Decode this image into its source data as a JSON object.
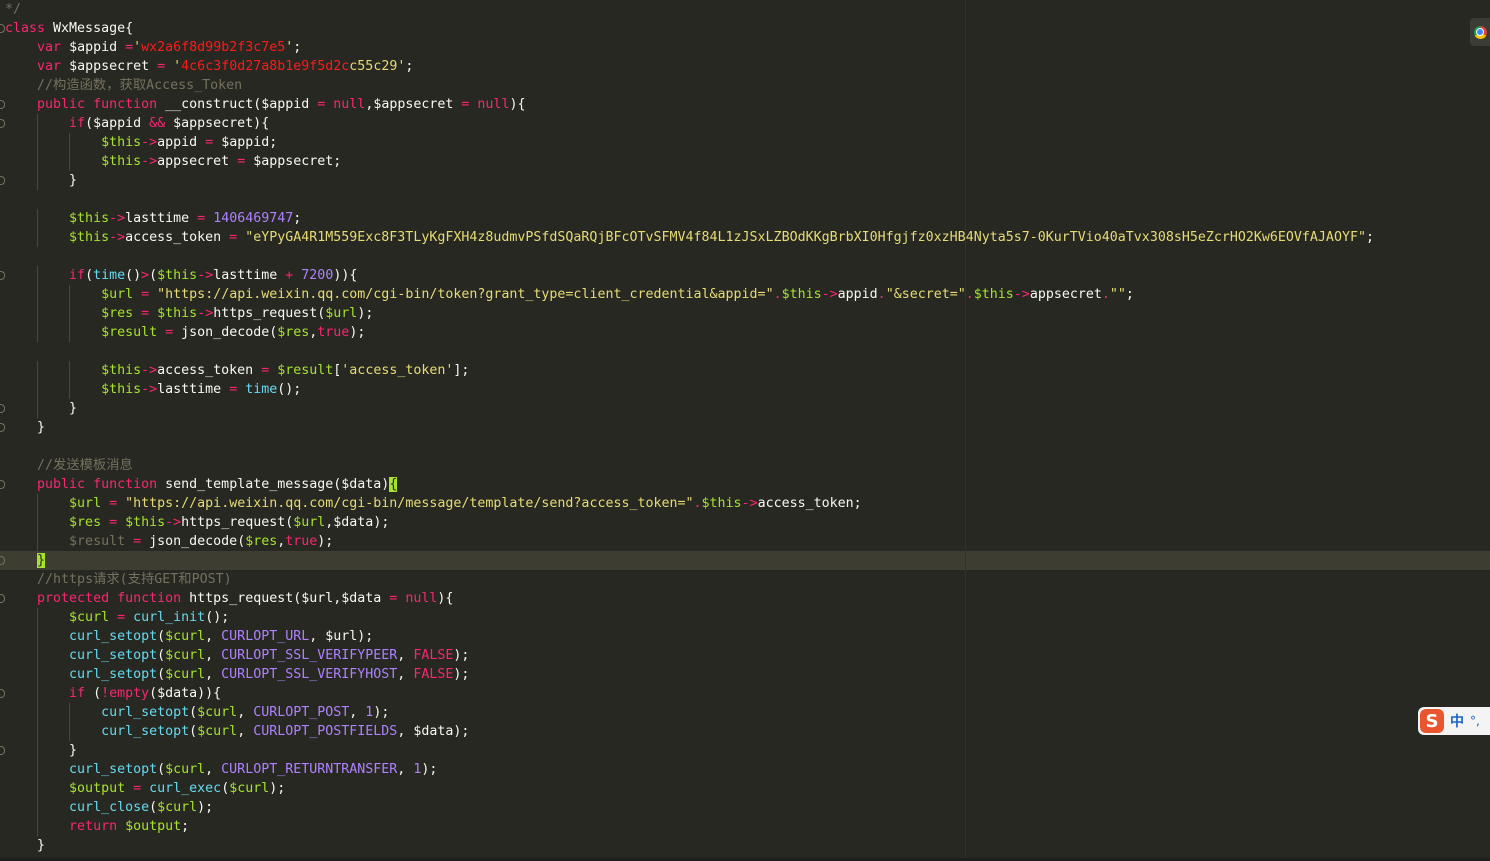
{
  "editor": {
    "theme": {
      "background": "#272822",
      "keyword": "#f92672",
      "string": "#e6db74",
      "variable": "#a6e22e",
      "builtin": "#66d9ef",
      "comment": "#75715e",
      "number": "#ae81ff"
    },
    "lines": [
      {
        "fold": false,
        "indent": 0,
        "tokens": [
          [
            "c",
            "*/"
          ]
        ]
      },
      {
        "fold": true,
        "indent": 0,
        "tokens": [
          [
            "k",
            "class"
          ],
          [
            "d",
            " WxMessage{"
          ]
        ]
      },
      {
        "fold": false,
        "indent": 1,
        "tokens": [
          [
            "k",
            "var"
          ],
          [
            "d",
            " $appid "
          ],
          [
            "o",
            "="
          ],
          [
            "s",
            "'"
          ],
          [
            "r",
            "wx2a6f8d99b2f3c7e5"
          ],
          [
            "s",
            "'"
          ],
          [
            "d",
            ";"
          ]
        ]
      },
      {
        "fold": false,
        "indent": 1,
        "tokens": [
          [
            "k",
            "var"
          ],
          [
            "d",
            " $appsecret "
          ],
          [
            "o",
            "="
          ],
          [
            "s",
            " '"
          ],
          [
            "r",
            "4c6c3f0d27a8b1e9f5d2c"
          ],
          [
            "s",
            "c55c29'"
          ],
          [
            "d",
            ";"
          ]
        ]
      },
      {
        "fold": false,
        "indent": 1,
        "tokens": [
          [
            "c",
            "//构造函数，获取Access_Token"
          ]
        ]
      },
      {
        "fold": true,
        "indent": 1,
        "tokens": [
          [
            "k",
            "public"
          ],
          [
            "d",
            " "
          ],
          [
            "k",
            "function"
          ],
          [
            "d",
            " __construct($appid "
          ],
          [
            "o",
            "="
          ],
          [
            "d",
            " "
          ],
          [
            "k",
            "null"
          ],
          [
            "d",
            ",$appsecret "
          ],
          [
            "o",
            "="
          ],
          [
            "d",
            " "
          ],
          [
            "k",
            "null"
          ],
          [
            "d",
            "){"
          ]
        ]
      },
      {
        "fold": true,
        "indent": 2,
        "tokens": [
          [
            "k",
            "if"
          ],
          [
            "d",
            "($appid "
          ],
          [
            "o",
            "&&"
          ],
          [
            "d",
            " $appsecret){"
          ]
        ]
      },
      {
        "fold": false,
        "indent": 3,
        "tokens": [
          [
            "v",
            "$this"
          ],
          [
            "o",
            "->"
          ],
          [
            "d",
            "appid "
          ],
          [
            "o",
            "="
          ],
          [
            "d",
            " $appid;"
          ]
        ]
      },
      {
        "fold": false,
        "indent": 3,
        "tokens": [
          [
            "v",
            "$this"
          ],
          [
            "o",
            "->"
          ],
          [
            "d",
            "appsecret "
          ],
          [
            "o",
            "="
          ],
          [
            "d",
            " $appsecret;"
          ]
        ]
      },
      {
        "fold": true,
        "indent": 2,
        "tokens": [
          [
            "d",
            "}"
          ]
        ]
      },
      {
        "fold": false,
        "indent": 0,
        "tokens": []
      },
      {
        "fold": false,
        "indent": 2,
        "tokens": [
          [
            "v",
            "$this"
          ],
          [
            "o",
            "->"
          ],
          [
            "d",
            "lasttime "
          ],
          [
            "o",
            "="
          ],
          [
            "d",
            " "
          ],
          [
            "n",
            "1406469747"
          ],
          [
            "d",
            ";"
          ]
        ]
      },
      {
        "fold": false,
        "indent": 2,
        "tokens": [
          [
            "v",
            "$this"
          ],
          [
            "o",
            "->"
          ],
          [
            "d",
            "access_token "
          ],
          [
            "o",
            "="
          ],
          [
            "d",
            " "
          ],
          [
            "s",
            "\"eYPyGA4R1M559Exc8F3TLyKgFXH4z8udmvPSfdSQaRQjBFcOTvSFMV4f84L1zJSxLZBOdKKgBrbXI0Hfgjfz0xzHB4Nyta5s7-0KurTVio40aTvx308sH5eZcrHO2Kw6EOVfAJAOYF\""
          ],
          [
            "d",
            ";"
          ]
        ]
      },
      {
        "fold": false,
        "indent": 0,
        "tokens": []
      },
      {
        "fold": true,
        "indent": 2,
        "tokens": [
          [
            "k",
            "if"
          ],
          [
            "d",
            "("
          ],
          [
            "f",
            "time"
          ],
          [
            "d",
            "()"
          ],
          [
            "o",
            ">"
          ],
          [
            "d",
            "("
          ],
          [
            "v",
            "$this"
          ],
          [
            "o",
            "->"
          ],
          [
            "d",
            "lasttime "
          ],
          [
            "o",
            "+"
          ],
          [
            "d",
            " "
          ],
          [
            "n",
            "7200"
          ],
          [
            "d",
            ")){"
          ]
        ]
      },
      {
        "fold": false,
        "indent": 3,
        "tokens": [
          [
            "v",
            "$url"
          ],
          [
            "d",
            " "
          ],
          [
            "o",
            "="
          ],
          [
            "d",
            " "
          ],
          [
            "s",
            "\"https://api.weixin.qq.com/cgi-bin/token?grant_type=client_credential&appid=\""
          ],
          [
            "o",
            "."
          ],
          [
            "v",
            "$this"
          ],
          [
            "o",
            "->"
          ],
          [
            "d",
            "appid"
          ],
          [
            "o",
            "."
          ],
          [
            "s",
            "\"&secret=\""
          ],
          [
            "o",
            "."
          ],
          [
            "v",
            "$this"
          ],
          [
            "o",
            "->"
          ],
          [
            "d",
            "appsecret"
          ],
          [
            "o",
            "."
          ],
          [
            "s",
            "\"\""
          ],
          [
            "d",
            ";"
          ]
        ]
      },
      {
        "fold": false,
        "indent": 3,
        "tokens": [
          [
            "v",
            "$res"
          ],
          [
            "d",
            " "
          ],
          [
            "o",
            "="
          ],
          [
            "d",
            " "
          ],
          [
            "v",
            "$this"
          ],
          [
            "o",
            "->"
          ],
          [
            "d",
            "https_request("
          ],
          [
            "v",
            "$url"
          ],
          [
            "d",
            ");"
          ]
        ]
      },
      {
        "fold": false,
        "indent": 3,
        "tokens": [
          [
            "v",
            "$result"
          ],
          [
            "d",
            " "
          ],
          [
            "o",
            "="
          ],
          [
            "d",
            " json_decode("
          ],
          [
            "v",
            "$res"
          ],
          [
            "d",
            ","
          ],
          [
            "k",
            "true"
          ],
          [
            "d",
            ");"
          ]
        ]
      },
      {
        "fold": false,
        "indent": 0,
        "tokens": []
      },
      {
        "fold": false,
        "indent": 3,
        "tokens": [
          [
            "v",
            "$this"
          ],
          [
            "o",
            "->"
          ],
          [
            "d",
            "access_token "
          ],
          [
            "o",
            "="
          ],
          [
            "d",
            " "
          ],
          [
            "v",
            "$result"
          ],
          [
            "d",
            "["
          ],
          [
            "s",
            "'access_token'"
          ],
          [
            "d",
            "];"
          ]
        ]
      },
      {
        "fold": false,
        "indent": 3,
        "tokens": [
          [
            "v",
            "$this"
          ],
          [
            "o",
            "->"
          ],
          [
            "d",
            "lasttime "
          ],
          [
            "o",
            "="
          ],
          [
            "d",
            " "
          ],
          [
            "f",
            "time"
          ],
          [
            "d",
            "();"
          ]
        ]
      },
      {
        "fold": true,
        "indent": 2,
        "tokens": [
          [
            "d",
            "}"
          ]
        ]
      },
      {
        "fold": true,
        "indent": 1,
        "tokens": [
          [
            "d",
            "}"
          ]
        ]
      },
      {
        "fold": false,
        "indent": 0,
        "tokens": []
      },
      {
        "fold": false,
        "indent": 1,
        "tokens": [
          [
            "c",
            "//发送模板消息"
          ]
        ]
      },
      {
        "fold": true,
        "indent": 1,
        "tokens": [
          [
            "k",
            "public"
          ],
          [
            "d",
            " "
          ],
          [
            "k",
            "function"
          ],
          [
            "d",
            " send_template_message($data)"
          ],
          [
            "h",
            "{"
          ]
        ]
      },
      {
        "fold": false,
        "indent": 2,
        "tokens": [
          [
            "v",
            "$url"
          ],
          [
            "d",
            " "
          ],
          [
            "o",
            "="
          ],
          [
            "d",
            " "
          ],
          [
            "s",
            "\"https://api.weixin.qq.com/cgi-bin/message/template/send?access_token=\""
          ],
          [
            "o",
            "."
          ],
          [
            "v",
            "$this"
          ],
          [
            "o",
            "->"
          ],
          [
            "d",
            "access_token;"
          ]
        ]
      },
      {
        "fold": false,
        "indent": 2,
        "tokens": [
          [
            "v",
            "$res"
          ],
          [
            "d",
            " "
          ],
          [
            "o",
            "="
          ],
          [
            "d",
            " "
          ],
          [
            "v",
            "$this"
          ],
          [
            "o",
            "->"
          ],
          [
            "d",
            "https_request("
          ],
          [
            "v",
            "$url"
          ],
          [
            "d",
            ",$data);"
          ]
        ]
      },
      {
        "fold": false,
        "indent": 2,
        "tokens": [
          [
            "c",
            "$result"
          ],
          [
            "d",
            " "
          ],
          [
            "o",
            "="
          ],
          [
            "d",
            " json_decode("
          ],
          [
            "v",
            "$res"
          ],
          [
            "d",
            ","
          ],
          [
            "k",
            "true"
          ],
          [
            "d",
            ");"
          ]
        ]
      },
      {
        "fold": true,
        "indent": 1,
        "current": true,
        "tokens": [
          [
            "h",
            "}"
          ]
        ]
      },
      {
        "fold": false,
        "indent": 1,
        "tokens": [
          [
            "c",
            "//https请求(支持GET和POST)"
          ]
        ]
      },
      {
        "fold": true,
        "indent": 1,
        "tokens": [
          [
            "k",
            "protected"
          ],
          [
            "d",
            " "
          ],
          [
            "k",
            "function"
          ],
          [
            "d",
            " https_request($url,$data "
          ],
          [
            "o",
            "="
          ],
          [
            "d",
            " "
          ],
          [
            "k",
            "null"
          ],
          [
            "d",
            "){"
          ]
        ]
      },
      {
        "fold": false,
        "indent": 2,
        "tokens": [
          [
            "v",
            "$curl"
          ],
          [
            "d",
            " "
          ],
          [
            "o",
            "="
          ],
          [
            "d",
            " "
          ],
          [
            "f",
            "curl_init"
          ],
          [
            "d",
            "();"
          ]
        ]
      },
      {
        "fold": false,
        "indent": 2,
        "tokens": [
          [
            "f",
            "curl_setopt"
          ],
          [
            "d",
            "("
          ],
          [
            "v",
            "$curl"
          ],
          [
            "d",
            ", "
          ],
          [
            "n",
            "CURLOPT_URL"
          ],
          [
            "d",
            ", $url);"
          ]
        ]
      },
      {
        "fold": false,
        "indent": 2,
        "tokens": [
          [
            "f",
            "curl_setopt"
          ],
          [
            "d",
            "("
          ],
          [
            "v",
            "$curl"
          ],
          [
            "d",
            ", "
          ],
          [
            "n",
            "CURLOPT_SSL_VERIFYPEER"
          ],
          [
            "d",
            ", "
          ],
          [
            "k",
            "FALSE"
          ],
          [
            "d",
            ");"
          ]
        ]
      },
      {
        "fold": false,
        "indent": 2,
        "tokens": [
          [
            "f",
            "curl_setopt"
          ],
          [
            "d",
            "("
          ],
          [
            "v",
            "$curl"
          ],
          [
            "d",
            ", "
          ],
          [
            "n",
            "CURLOPT_SSL_VERIFYHOST"
          ],
          [
            "d",
            ", "
          ],
          [
            "k",
            "FALSE"
          ],
          [
            "d",
            ");"
          ]
        ]
      },
      {
        "fold": true,
        "indent": 2,
        "tokens": [
          [
            "k",
            "if"
          ],
          [
            "d",
            " ("
          ],
          [
            "o",
            "!"
          ],
          [
            "k",
            "empty"
          ],
          [
            "d",
            "($data)){"
          ]
        ]
      },
      {
        "fold": false,
        "indent": 3,
        "tokens": [
          [
            "f",
            "curl_setopt"
          ],
          [
            "d",
            "("
          ],
          [
            "v",
            "$curl"
          ],
          [
            "d",
            ", "
          ],
          [
            "n",
            "CURLOPT_POST"
          ],
          [
            "d",
            ", "
          ],
          [
            "n",
            "1"
          ],
          [
            "d",
            ");"
          ]
        ]
      },
      {
        "fold": false,
        "indent": 3,
        "tokens": [
          [
            "f",
            "curl_setopt"
          ],
          [
            "d",
            "("
          ],
          [
            "v",
            "$curl"
          ],
          [
            "d",
            ", "
          ],
          [
            "n",
            "CURLOPT_POSTFIELDS"
          ],
          [
            "d",
            ", $data);"
          ]
        ]
      },
      {
        "fold": true,
        "indent": 2,
        "tokens": [
          [
            "d",
            "}"
          ]
        ]
      },
      {
        "fold": false,
        "indent": 2,
        "tokens": [
          [
            "f",
            "curl_setopt"
          ],
          [
            "d",
            "("
          ],
          [
            "v",
            "$curl"
          ],
          [
            "d",
            ", "
          ],
          [
            "n",
            "CURLOPT_RETURNTRANSFER"
          ],
          [
            "d",
            ", "
          ],
          [
            "n",
            "1"
          ],
          [
            "d",
            ");"
          ]
        ]
      },
      {
        "fold": false,
        "indent": 2,
        "tokens": [
          [
            "v",
            "$output"
          ],
          [
            "d",
            " "
          ],
          [
            "o",
            "="
          ],
          [
            "d",
            " "
          ],
          [
            "f",
            "curl_exec"
          ],
          [
            "d",
            "("
          ],
          [
            "v",
            "$curl"
          ],
          [
            "d",
            ");"
          ]
        ]
      },
      {
        "fold": false,
        "indent": 2,
        "tokens": [
          [
            "f",
            "curl_close"
          ],
          [
            "d",
            "("
          ],
          [
            "v",
            "$curl"
          ],
          [
            "d",
            ");"
          ]
        ]
      },
      {
        "fold": false,
        "indent": 2,
        "tokens": [
          [
            "k",
            "return"
          ],
          [
            "d",
            " "
          ],
          [
            "v",
            "$output"
          ],
          [
            "d",
            ";"
          ]
        ]
      },
      {
        "fold": false,
        "indent": 1,
        "tokens": [
          [
            "d",
            "}"
          ]
        ]
      }
    ]
  },
  "overlays": {
    "browser_icon": "chrome-icon",
    "ime": {
      "logo": "S",
      "mode": "中",
      "punct": "°,"
    }
  }
}
